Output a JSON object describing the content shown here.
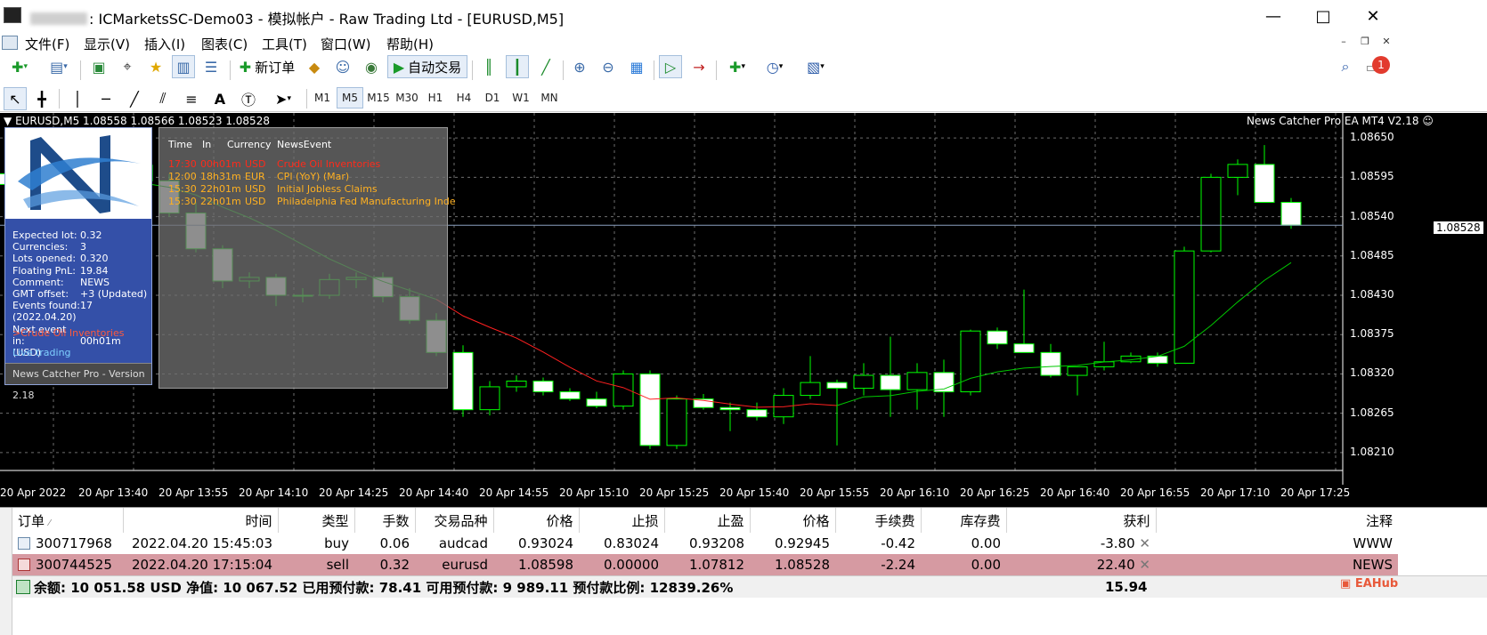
{
  "window": {
    "title_account": "ICMarketsSC-Demo03 - 模拟帐户 - Raw Trading Ltd - [EURUSD,M5]",
    "title_prefix": ": "
  },
  "menu": [
    "文件(F)",
    "显示(V)",
    "插入(I)",
    "图表(C)",
    "工具(T)",
    "窗口(W)",
    "帮助(H)"
  ],
  "toolbar": {
    "new_order_label": "新订单",
    "auto_trading_label": "自动交易",
    "notification_count": "1"
  },
  "timeframes": [
    "M1",
    "M5",
    "M15",
    "M30",
    "H1",
    "H4",
    "D1",
    "W1",
    "MN"
  ],
  "active_timeframe": "M5",
  "chart": {
    "symbol_header": "EURUSD,M5  1.08558 1.08566 1.08523 1.08528",
    "ea_header": "News Catcher Pro EA MT4 V2.18",
    "current_price": "1.08528",
    "colors": {
      "background": "#000000",
      "bull_fill": "#000000",
      "bear_fill": "#ffffff",
      "wick": "#00ff00",
      "ma": "#00c800",
      "ma_red": "#ff2020",
      "grid": "#6e6e6e"
    }
  },
  "chart_data": {
    "type": "candlestick",
    "symbol": "EURUSD",
    "timeframe": "M5",
    "ylim": [
      1.08185,
      1.08685
    ],
    "price_ticks": [
      "1.08650",
      "1.08595",
      "1.08540",
      "1.08485",
      "1.08430",
      "1.08375",
      "1.08320",
      "1.08265",
      "1.08210"
    ],
    "time_ticks": [
      "20 Apr 2022",
      "20 Apr 13:40",
      "20 Apr 13:55",
      "20 Apr 14:10",
      "20 Apr 14:25",
      "20 Apr 14:40",
      "20 Apr 14:55",
      "20 Apr 15:10",
      "20 Apr 15:25",
      "20 Apr 15:40",
      "20 Apr 15:55",
      "20 Apr 16:10",
      "20 Apr 16:25",
      "20 Apr 16:40",
      "20 Apr 16:55",
      "20 Apr 17:10",
      "20 Apr 17:25"
    ],
    "candles": [
      {
        "o": 1.086,
        "h": 1.08615,
        "l": 1.0858,
        "c": 1.08585
      },
      {
        "o": 1.0858,
        "h": 1.08595,
        "l": 1.0857,
        "c": 1.08575
      },
      {
        "o": 1.08575,
        "h": 1.086,
        "l": 1.08565,
        "c": 1.0857
      },
      {
        "o": 1.0857,
        "h": 1.08585,
        "l": 1.0856,
        "c": 1.0859
      },
      {
        "o": 1.0859,
        "h": 1.0862,
        "l": 1.08575,
        "c": 1.08612
      },
      {
        "o": 1.08612,
        "h": 1.08625,
        "l": 1.0858,
        "c": 1.0859
      },
      {
        "o": 1.0859,
        "h": 1.086,
        "l": 1.0854,
        "c": 1.08545
      },
      {
        "o": 1.08545,
        "h": 1.0856,
        "l": 1.0849,
        "c": 1.08495
      },
      {
        "o": 1.08495,
        "h": 1.085,
        "l": 1.0844,
        "c": 1.0845
      },
      {
        "o": 1.0845,
        "h": 1.08462,
        "l": 1.0844,
        "c": 1.08455
      },
      {
        "o": 1.08455,
        "h": 1.0846,
        "l": 1.08415,
        "c": 1.0843
      },
      {
        "o": 1.0843,
        "h": 1.0844,
        "l": 1.0842,
        "c": 1.0843
      },
      {
        "o": 1.0843,
        "h": 1.0846,
        "l": 1.08425,
        "c": 1.08452
      },
      {
        "o": 1.08452,
        "h": 1.08462,
        "l": 1.0844,
        "c": 1.08455
      },
      {
        "o": 1.08455,
        "h": 1.08462,
        "l": 1.0842,
        "c": 1.08428
      },
      {
        "o": 1.08428,
        "h": 1.0844,
        "l": 1.0839,
        "c": 1.08395
      },
      {
        "o": 1.08395,
        "h": 1.08405,
        "l": 1.08345,
        "c": 1.0835
      },
      {
        "o": 1.0835,
        "h": 1.0836,
        "l": 1.0826,
        "c": 1.0827
      },
      {
        "o": 1.0827,
        "h": 1.0831,
        "l": 1.08262,
        "c": 1.08302
      },
      {
        "o": 1.08302,
        "h": 1.08318,
        "l": 1.08295,
        "c": 1.0831
      },
      {
        "o": 1.0831,
        "h": 1.08315,
        "l": 1.0829,
        "c": 1.08295
      },
      {
        "o": 1.08295,
        "h": 1.083,
        "l": 1.08282,
        "c": 1.08285
      },
      {
        "o": 1.08285,
        "h": 1.08295,
        "l": 1.08272,
        "c": 1.08275
      },
      {
        "o": 1.08275,
        "h": 1.08325,
        "l": 1.0827,
        "c": 1.0832
      },
      {
        "o": 1.0832,
        "h": 1.08325,
        "l": 1.08215,
        "c": 1.0822
      },
      {
        "o": 1.0822,
        "h": 1.0829,
        "l": 1.08215,
        "c": 1.08285
      },
      {
        "o": 1.08285,
        "h": 1.08292,
        "l": 1.0827,
        "c": 1.08273
      },
      {
        "o": 1.08273,
        "h": 1.0828,
        "l": 1.0824,
        "c": 1.0827
      },
      {
        "o": 1.0827,
        "h": 1.0828,
        "l": 1.08255,
        "c": 1.0826
      },
      {
        "o": 1.0826,
        "h": 1.083,
        "l": 1.0825,
        "c": 1.0829
      },
      {
        "o": 1.0829,
        "h": 1.08345,
        "l": 1.08285,
        "c": 1.08308
      },
      {
        "o": 1.08308,
        "h": 1.08312,
        "l": 1.0822,
        "c": 1.083
      },
      {
        "o": 1.083,
        "h": 1.08335,
        "l": 1.0829,
        "c": 1.08318
      },
      {
        "o": 1.08318,
        "h": 1.08372,
        "l": 1.0826,
        "c": 1.08298
      },
      {
        "o": 1.08298,
        "h": 1.08335,
        "l": 1.0827,
        "c": 1.08322
      },
      {
        "o": 1.08322,
        "h": 1.0834,
        "l": 1.0826,
        "c": 1.08295
      },
      {
        "o": 1.08295,
        "h": 1.08382,
        "l": 1.0829,
        "c": 1.0838
      },
      {
        "o": 1.0838,
        "h": 1.08385,
        "l": 1.08355,
        "c": 1.08362
      },
      {
        "o": 1.08362,
        "h": 1.08438,
        "l": 1.0835,
        "c": 1.0835
      },
      {
        "o": 1.0835,
        "h": 1.08362,
        "l": 1.08315,
        "c": 1.08318
      },
      {
        "o": 1.08318,
        "h": 1.0833,
        "l": 1.0829,
        "c": 1.0833
      },
      {
        "o": 1.0833,
        "h": 1.08365,
        "l": 1.08325,
        "c": 1.08337
      },
      {
        "o": 1.08337,
        "h": 1.0835,
        "l": 1.08335,
        "c": 1.08345
      },
      {
        "o": 1.08345,
        "h": 1.0835,
        "l": 1.0833,
        "c": 1.08335
      },
      {
        "o": 1.08335,
        "h": 1.08498,
        "l": 1.08335,
        "c": 1.08492
      },
      {
        "o": 1.08492,
        "h": 1.086,
        "l": 1.0849,
        "c": 1.08595
      },
      {
        "o": 1.08595,
        "h": 1.0862,
        "l": 1.0857,
        "c": 1.08613
      },
      {
        "o": 1.08613,
        "h": 1.0864,
        "l": 1.0856,
        "c": 1.0856
      },
      {
        "o": 1.0856,
        "h": 1.08566,
        "l": 1.08523,
        "c": 1.08528
      }
    ]
  },
  "ea_panel": {
    "info": [
      {
        "k": "Expected lot:",
        "v": "0.32"
      },
      {
        "k": "Currencies:",
        "v": "3"
      },
      {
        "k": "Lots opened:",
        "v": "0.320"
      },
      {
        "k": "Floating PnL:",
        "v": "19.84"
      },
      {
        "k": "Comment:",
        "v": "NEWS"
      },
      {
        "k": "GMT offset:",
        "v": "+3 (Updated)"
      },
      {
        "k": "Events found:",
        "v": "17 (2022.04.20)"
      },
      {
        "k": "Next event in:",
        "v": "00h01m (USD)"
      }
    ],
    "next_event": ">Crude Oil Inventories",
    "mode": "Live trading",
    "version": "News Catcher Pro - Version 2.18"
  },
  "news_panel": {
    "headers": [
      "Time",
      "In",
      "Currency",
      "NewsEvent"
    ],
    "rows": [
      {
        "time": "17:30",
        "in": "00h01m",
        "currency": "USD",
        "event": "Crude Oil Inventories",
        "color": "#ff2a1a"
      },
      {
        "time": "12:00",
        "in": "18h31m",
        "currency": "EUR",
        "event": "CPI (YoY) (Mar)",
        "color": "#ffb020"
      },
      {
        "time": "15:30",
        "in": "22h01m",
        "currency": "USD",
        "event": "Initial Jobless Claims",
        "color": "#ffb020"
      },
      {
        "time": "15:30",
        "in": "22h01m",
        "currency": "USD",
        "event": "Philadelphia Fed Manufacturing Inde",
        "color": "#ffb020"
      }
    ]
  },
  "terminal": {
    "columns": [
      "订单",
      "时间",
      "类型",
      "手数",
      "交易品种",
      "价格",
      "止损",
      "止盈",
      "价格",
      "手续费",
      "库存费",
      "获利",
      "注释"
    ],
    "orders": [
      {
        "ticket": "300717968",
        "time": "2022.04.20 15:45:03",
        "type": "buy",
        "lots": "0.06",
        "symbol": "audcad",
        "price": "0.93024",
        "sl": "0.83024",
        "tp": "0.93208",
        "current": "0.92945",
        "commission": "-0.42",
        "swap": "0.00",
        "profit": "-3.80",
        "comment": "WWW"
      },
      {
        "ticket": "300744525",
        "time": "2022.04.20 17:15:04",
        "type": "sell",
        "lots": "0.32",
        "symbol": "eurusd",
        "price": "1.08598",
        "sl": "0.00000",
        "tp": "1.07812",
        "current": "1.08528",
        "commission": "-2.24",
        "swap": "0.00",
        "profit": "22.40",
        "comment": "NEWS"
      }
    ],
    "summary": "余额: 10 051.58 USD  净值: 10 067.52  已用预付款: 78.41  可用预付款: 9 989.11  预付款比例: 12839.26%",
    "total_profit": "15.94",
    "brand": "EAHub"
  }
}
